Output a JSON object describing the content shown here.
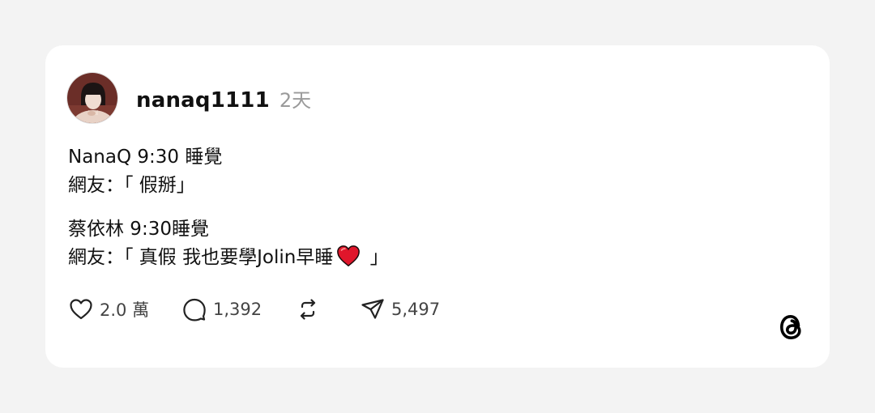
{
  "post": {
    "username": "nanaq1111",
    "time": "2天",
    "paragraphs": [
      {
        "line1": "NanaQ 9:30 睡覺",
        "line2": "網友：「 假掰」"
      },
      {
        "line1": "蔡依林 9:30睡覺",
        "line2_before_emoji": "網友：「 真假 我也要學Jolin早睡",
        "line2_emoji": "heart-emoji",
        "line2_after_emoji": " 」"
      }
    ]
  },
  "actions": {
    "likes": "2.0 萬",
    "replies": "1,392",
    "shares": "5,497"
  },
  "icons": {
    "like": "heart-outline-icon",
    "reply": "speech-bubble-icon",
    "repost": "repost-icon",
    "share": "paper-plane-icon",
    "brand": "threads-logo-icon"
  },
  "colors": {
    "background": "#f3f3f3",
    "card": "#ffffff",
    "text": "#111111",
    "muted": "#9a9a9a",
    "heart": "#e0162b"
  }
}
